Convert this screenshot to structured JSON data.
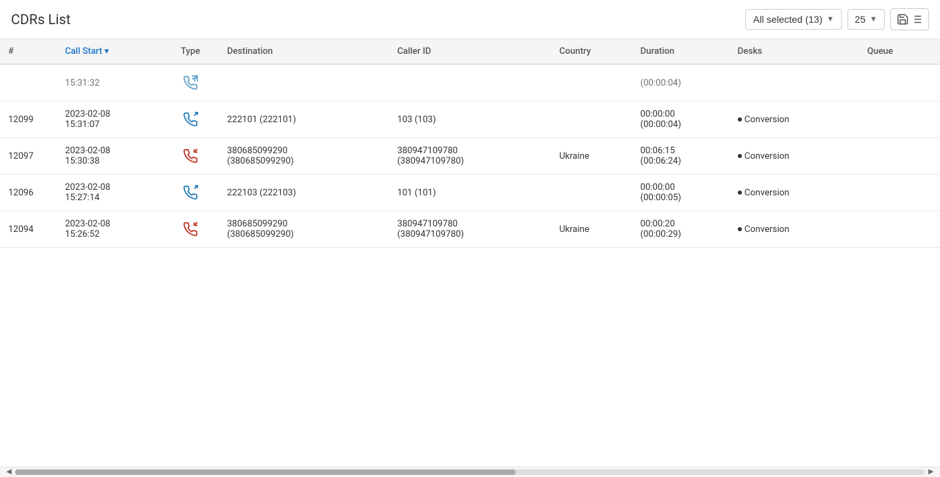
{
  "header": {
    "title": "CDRs List",
    "all_selected_label": "All selected (13)",
    "per_page": "25",
    "icons": {
      "save": "save-icon",
      "sort": "sort-icon"
    }
  },
  "table": {
    "columns": [
      {
        "id": "num",
        "label": "#"
      },
      {
        "id": "call_start",
        "label": "Call Start",
        "sortable": true
      },
      {
        "id": "type",
        "label": "Type"
      },
      {
        "id": "destination",
        "label": "Destination"
      },
      {
        "id": "caller_id",
        "label": "Caller ID"
      },
      {
        "id": "country",
        "label": "Country"
      },
      {
        "id": "duration",
        "label": "Duration"
      },
      {
        "id": "desks",
        "label": "Desks"
      },
      {
        "id": "queue",
        "label": "Queue"
      }
    ],
    "rows": [
      {
        "id": "",
        "call_start": "15:31:32",
        "type": "outgoing",
        "destination": "",
        "caller_id": "",
        "country": "",
        "duration": "(00:00:04)",
        "desks": "",
        "queue": "",
        "partial": true
      },
      {
        "id": "12099",
        "call_start": "2023-02-08 15:31:07",
        "type": "outgoing",
        "destination": "222101 (222101)",
        "caller_id": "103 (103)",
        "country": "",
        "duration": "00:00:00\n(00:00:04)",
        "desks": "Conversion",
        "queue": ""
      },
      {
        "id": "12097",
        "call_start": "2023-02-08 15:30:38",
        "type": "incoming",
        "destination": "380685099290 (380685099290)",
        "caller_id": "380947109780 (380947109780)",
        "country": "Ukraine",
        "duration": "00:06:15\n(00:06:24)",
        "desks": "Conversion",
        "queue": ""
      },
      {
        "id": "12096",
        "call_start": "2023-02-08 15:27:14",
        "type": "outgoing",
        "destination": "222103 (222103)",
        "caller_id": "101 (101)",
        "country": "",
        "duration": "00:00:00\n(00:00:05)",
        "desks": "Conversion",
        "queue": ""
      },
      {
        "id": "12094",
        "call_start": "2023-02-08 15:26:52",
        "type": "incoming",
        "destination": "380685099290 (380685099290)",
        "caller_id": "380947109780 (380947109780)",
        "country": "Ukraine",
        "duration": "00:00:20\n(00:00:29)",
        "desks": "Conversion",
        "queue": ""
      }
    ]
  }
}
